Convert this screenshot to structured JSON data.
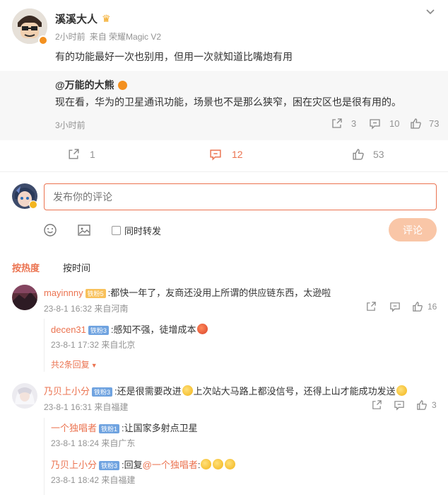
{
  "post": {
    "author": "溪溪大人",
    "time": "2小时前",
    "source": "来自 荣耀Magic V2",
    "text": "有的功能最好一次也别用，但用一次就知道比嘴炮有用",
    "repost_count": "1",
    "comment_count": "12",
    "like_count": "53"
  },
  "quoted": {
    "author": "@万能的大熊",
    "text": "现在看，华为的卫星通讯功能，场景也不是那么狭窄，困在灾区也是很有用的。",
    "time": "3小时前",
    "repost_count": "3",
    "comment_count": "10",
    "like_count": "73"
  },
  "composer": {
    "placeholder": "发布你的评论",
    "repost_label": "同时转发",
    "submit_label": "评论"
  },
  "sort": {
    "hot": "按热度",
    "time": "按时间"
  },
  "comments": [
    {
      "user": "mayinnny",
      "badge": "铁粉5",
      "text": ":都快一年了，友商还没用上所谓的供应链东西，太逊啦",
      "meta": "23-8-1 16:32 来自河南",
      "likes": "16",
      "replies": [
        {
          "user": "decen31",
          "badge": "铁粉3",
          "text": ":感知不强，徒增成本",
          "meta": "23-8-1 17:32 来自北京"
        }
      ],
      "more": "共2条回复"
    },
    {
      "user": "乃贝上小分",
      "badge": "铁粉3",
      "text_a": ":还是很需要改进",
      "text_b": "上次站大马路上都没信号，还得上山才能成功发送",
      "meta": "23-8-1 16:31 来自福建",
      "likes": "3",
      "replies": [
        {
          "user": "一个独唱者",
          "badge": "铁粉1",
          "text": ":让国家多射点卫星",
          "meta": "23-8-1 18:24 来自广东"
        },
        {
          "user": "乃贝上小分",
          "badge": "铁粉3",
          "text_a": ":回复",
          "mention": "@一个独唱者",
          "text_b": ":",
          "meta": "23-8-1 18:42 来自福建"
        }
      ]
    }
  ],
  "colors": {
    "accent": "#eb7350",
    "link": "#eb7350",
    "muted": "#939393",
    "quote_bg": "#f7f7f7"
  }
}
